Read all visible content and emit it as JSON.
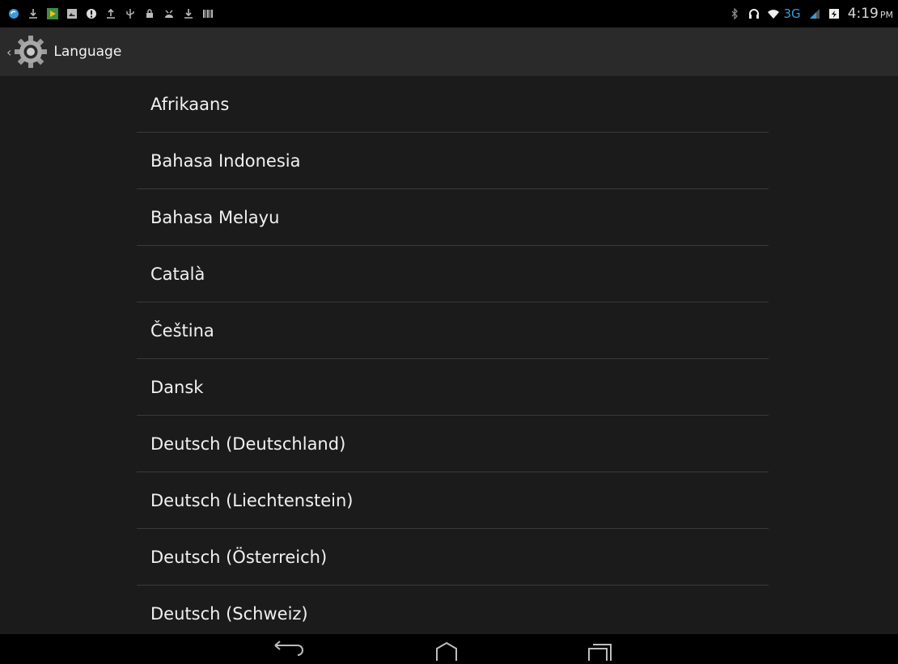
{
  "status_bar": {
    "network_type": "3G",
    "time": "4:19",
    "ampm": "PM"
  },
  "action_bar": {
    "title": "Language"
  },
  "languages": [
    "Afrikaans",
    "Bahasa Indonesia",
    "Bahasa Melayu",
    "Català",
    "Čeština",
    "Dansk",
    "Deutsch (Deutschland)",
    "Deutsch (Liechtenstein)",
    "Deutsch (Österreich)",
    "Deutsch (Schweiz)"
  ],
  "colors": {
    "background": "#1b1b1c",
    "action_bar": "#2a2a2b",
    "divider": "#3a3a3b",
    "accent_blue": "#3b9bd8"
  }
}
